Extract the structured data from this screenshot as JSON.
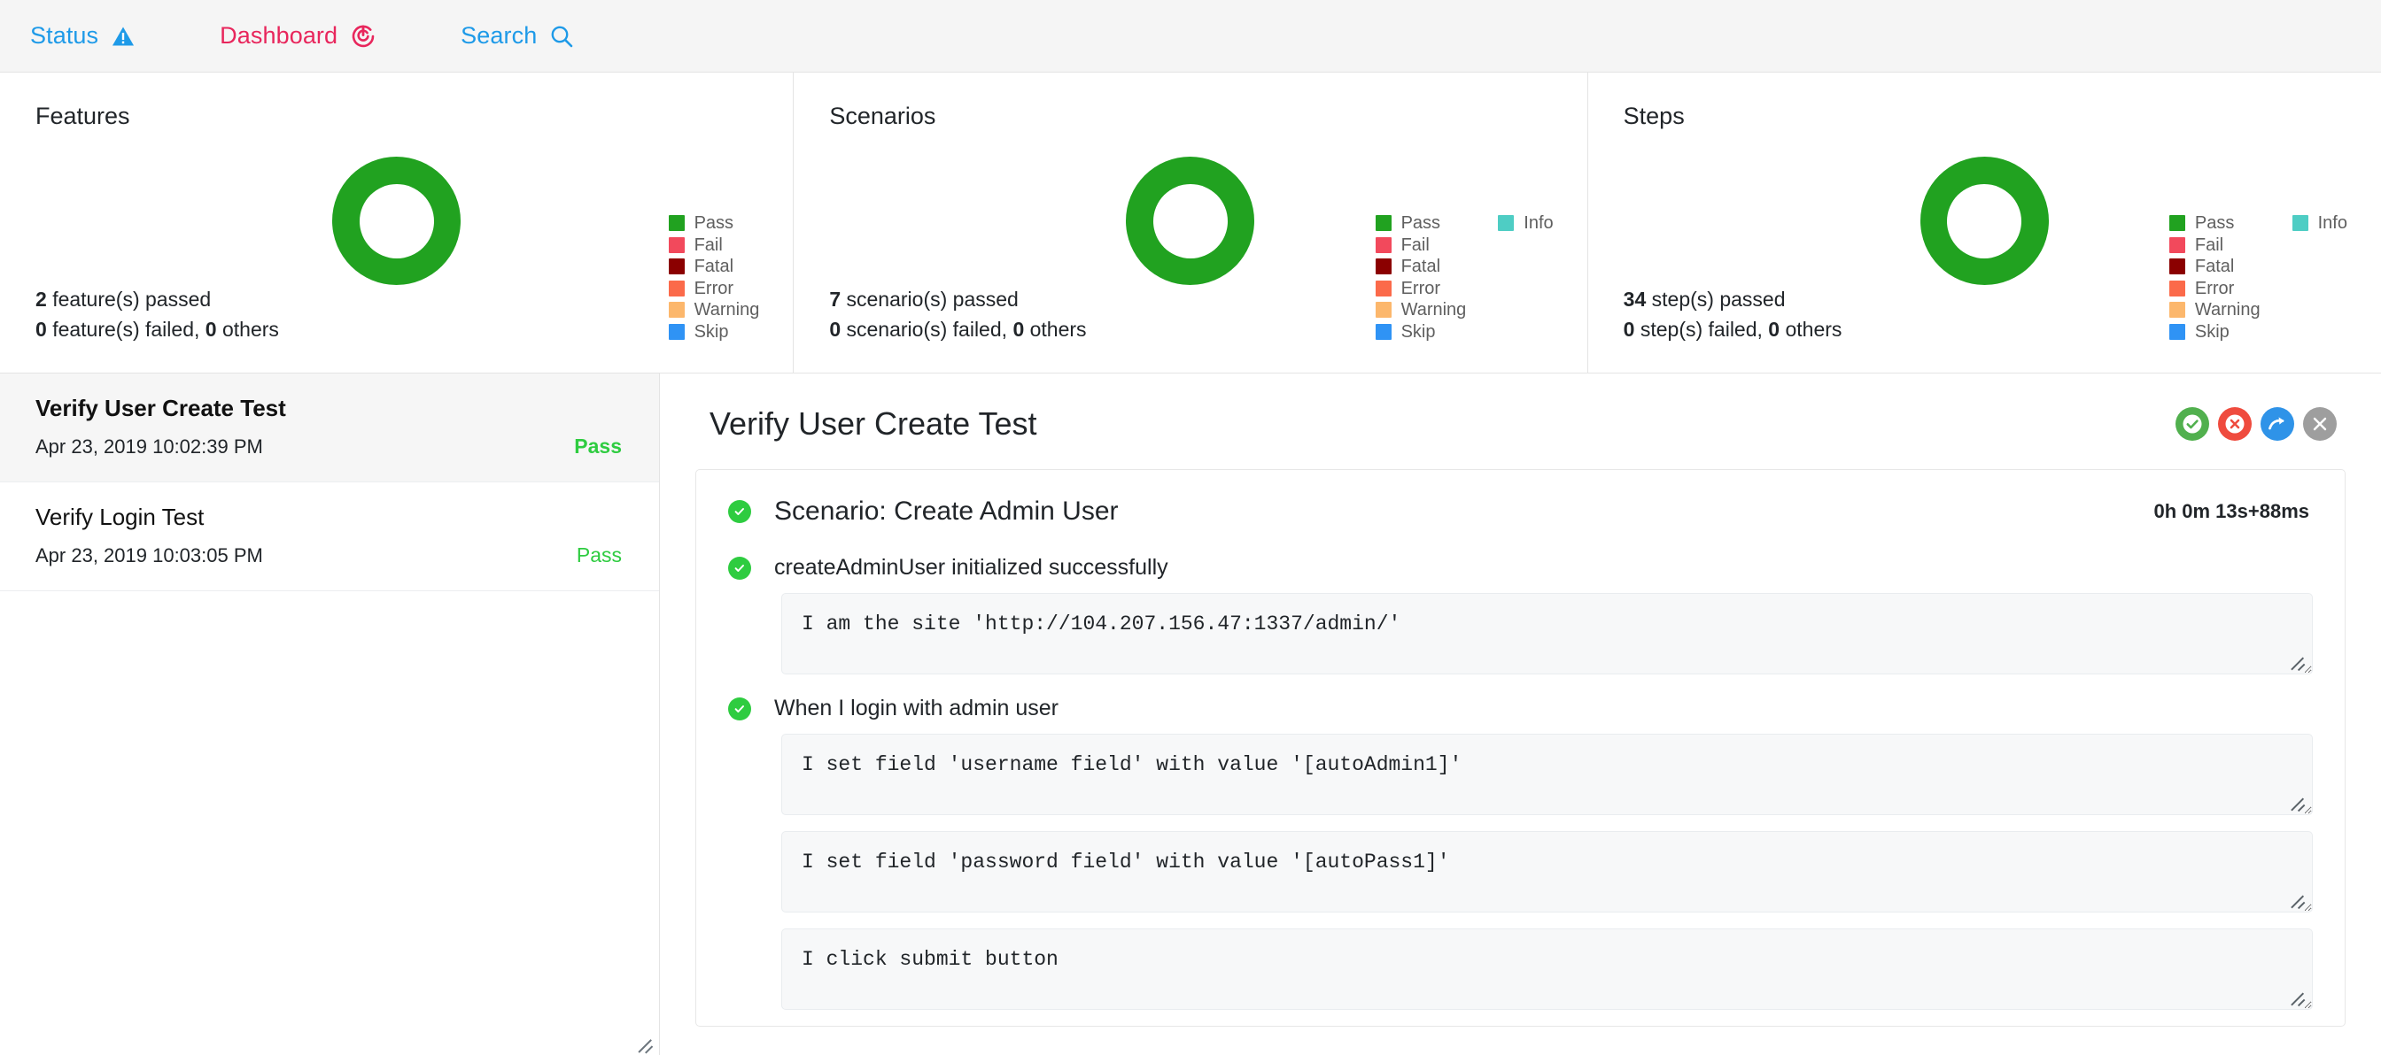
{
  "nav": {
    "items": [
      {
        "label": "Status",
        "icon": "warning-triangle-icon",
        "color": "#1e9ae8"
      },
      {
        "label": "Dashboard",
        "icon": "target-dashboard-icon",
        "color": "#e8265c"
      },
      {
        "label": "Search",
        "icon": "search-icon",
        "color": "#1e9ae8"
      }
    ]
  },
  "colors": {
    "pass": "#21a220",
    "fail": "#f2495c",
    "fatal": "#8b0000",
    "error": "#fb6a4a",
    "warning": "#fcb76c",
    "skip": "#2f93f5",
    "info": "#4ecdc4",
    "status_blue": "#1e9ae8",
    "dashboard_pink": "#e8265c",
    "pass_text": "#2ecc40"
  },
  "cards": [
    {
      "title": "Features",
      "passed_count": "2",
      "passed_text": "feature(s) passed",
      "failed_count": "0",
      "failed_text": "feature(s) failed,",
      "others_count": "0",
      "others_text": "others",
      "has_info": false
    },
    {
      "title": "Scenarios",
      "passed_count": "7",
      "passed_text": "scenario(s) passed",
      "failed_count": "0",
      "failed_text": "scenario(s) failed,",
      "others_count": "0",
      "others_text": "others",
      "has_info": true
    },
    {
      "title": "Steps",
      "passed_count": "34",
      "passed_text": "step(s) passed",
      "failed_count": "0",
      "failed_text": "step(s) failed,",
      "others_count": "0",
      "others_text": "others",
      "has_info": true
    }
  ],
  "legend": {
    "primary": [
      "Pass",
      "Fail",
      "Fatal",
      "Error",
      "Warning",
      "Skip"
    ],
    "secondary": [
      "Info"
    ]
  },
  "chart_data": [
    {
      "type": "pie",
      "title": "Features",
      "categories": [
        "Pass",
        "Fail",
        "Fatal",
        "Error",
        "Warning",
        "Skip",
        "Info"
      ],
      "values": [
        2,
        0,
        0,
        0,
        0,
        0,
        0
      ],
      "colors": [
        "#21a220",
        "#f2495c",
        "#8b0000",
        "#fb6a4a",
        "#fcb76c",
        "#2f93f5",
        "#4ecdc4"
      ],
      "legend_position": "right",
      "donut": true
    },
    {
      "type": "pie",
      "title": "Scenarios",
      "categories": [
        "Pass",
        "Fail",
        "Fatal",
        "Error",
        "Warning",
        "Skip",
        "Info"
      ],
      "values": [
        7,
        0,
        0,
        0,
        0,
        0,
        0
      ],
      "colors": [
        "#21a220",
        "#f2495c",
        "#8b0000",
        "#fb6a4a",
        "#fcb76c",
        "#2f93f5",
        "#4ecdc4"
      ],
      "legend_position": "right",
      "donut": true
    },
    {
      "type": "pie",
      "title": "Steps",
      "categories": [
        "Pass",
        "Fail",
        "Fatal",
        "Error",
        "Warning",
        "Skip",
        "Info"
      ],
      "values": [
        34,
        0,
        0,
        0,
        0,
        0,
        0
      ],
      "colors": [
        "#21a220",
        "#f2495c",
        "#8b0000",
        "#fb6a4a",
        "#fcb76c",
        "#2f93f5",
        "#4ecdc4"
      ],
      "legend_position": "right",
      "donut": true
    }
  ],
  "sidebar": {
    "tests": [
      {
        "name": "Verify User Create Test",
        "time": "Apr 23, 2019 10:02:39 PM",
        "status": "Pass",
        "active": true
      },
      {
        "name": "Verify Login Test",
        "time": "Apr 23, 2019 10:03:05 PM",
        "status": "Pass",
        "active": false
      }
    ]
  },
  "detail": {
    "title": "Verify User Create Test",
    "actions": [
      {
        "name": "mark-pass-button",
        "icon": "check-circle-icon"
      },
      {
        "name": "mark-fail-button",
        "icon": "x-circle-icon"
      },
      {
        "name": "rerun-button",
        "icon": "redo-arrow-icon"
      },
      {
        "name": "close-button",
        "icon": "close-icon"
      }
    ],
    "scenario": {
      "title": "Scenario: Create Admin User",
      "duration": "0h 0m 13s+88ms",
      "steps": [
        {
          "title": "createAdminUser initialized successfully",
          "status": "pass",
          "lines": [
            "I am the site 'http://104.207.156.47:1337/admin/'"
          ]
        },
        {
          "title": "When I login with admin user",
          "status": "pass",
          "lines": [
            "I set field 'username field' with value '[autoAdmin1]'",
            "I set field 'password field' with value '[autoPass1]'",
            "I click submit button"
          ]
        }
      ]
    }
  }
}
